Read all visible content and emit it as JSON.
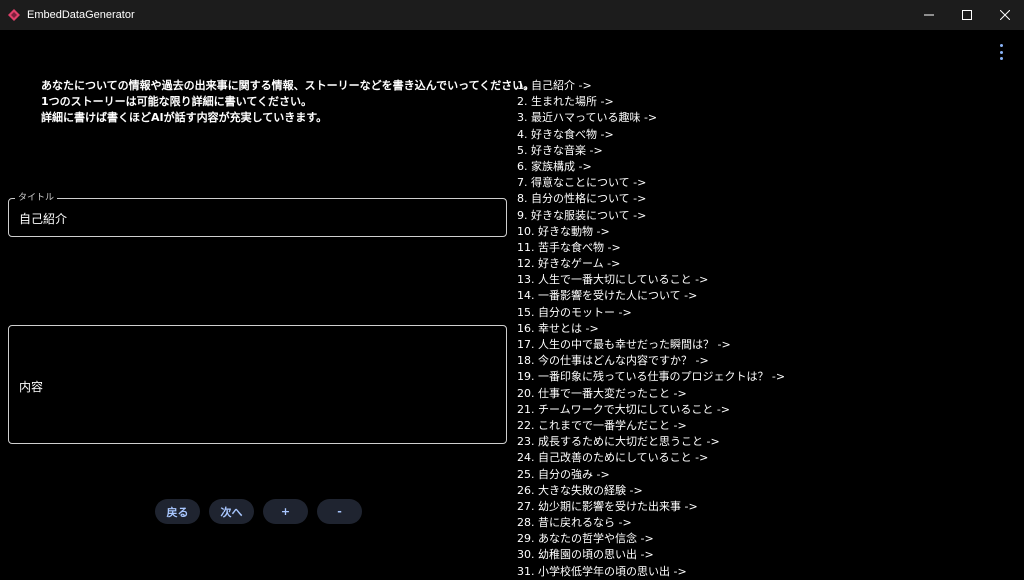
{
  "window": {
    "title": "EmbedDataGenerator",
    "minimize_glyph": "—",
    "accent": "#e0406a"
  },
  "instructions": [
    "あなたについての情報や過去の出来事に関する情報、ストーリーなどを書き込んでいってください。",
    "1つのストーリーは可能な限り詳細に書いてください。",
    "詳細に書けば書くほどAIが話す内容が充実していきます。"
  ],
  "title_field": {
    "label": "タイトル",
    "value": "自己紹介"
  },
  "content_field": {
    "placeholder": "内容"
  },
  "buttons": {
    "back": "戻る",
    "next": "次へ",
    "add": "+",
    "remove": "-"
  },
  "topics": [
    "1. 自己紹介 ->",
    "2. 生まれた場所 ->",
    "3. 最近ハマっている趣味 ->",
    "4. 好きな食べ物 ->",
    "5. 好きな音楽 ->",
    "6. 家族構成 ->",
    "7. 得意なことについて ->",
    "8. 自分の性格について ->",
    "9. 好きな服装について ->",
    "10. 好きな動物 ->",
    "11. 苦手な食べ物 ->",
    "12. 好きなゲーム ->",
    "13. 人生で一番大切にしていること ->",
    "14. 一番影響を受けた人について ->",
    "15. 自分のモットー ->",
    "16. 幸せとは ->",
    "17. 人生の中で最も幸せだった瞬間は？ ->",
    "18. 今の仕事はどんな内容ですか？ ->",
    "19. 一番印象に残っている仕事のプロジェクトは？ ->",
    "20. 仕事で一番大変だったこと ->",
    "21. チームワークで大切にしていること ->",
    "22. これまでで一番学んだこと ->",
    "23. 成長するために大切だと思うこと ->",
    "24. 自己改善のためにしていること ->",
    "25. 自分の強み ->",
    "26. 大きな失敗の経験 ->",
    "27. 幼少期に影響を受けた出来事 ->",
    "28. 昔に戻れるなら ->",
    "29. あなたの哲学や信念 ->",
    "30. 幼稚園の頃の思い出 ->",
    "31. 小学校低学年の頃の思い出 ->"
  ]
}
